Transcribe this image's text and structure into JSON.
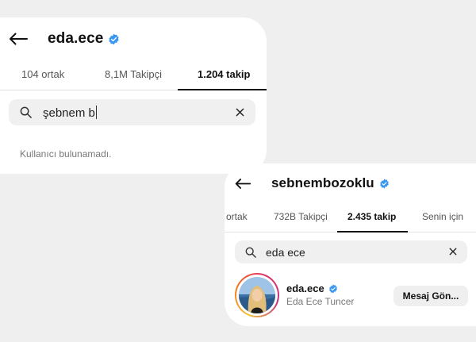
{
  "colors": {
    "verified": "#3897f0",
    "background": "#efefef",
    "card": "#ffffff",
    "search_bg": "#f0f0f0"
  },
  "card1": {
    "username": "eda.ece",
    "tabs": [
      {
        "label": "104 ortak",
        "active": false
      },
      {
        "label": "8,1M Takipçi",
        "active": false
      },
      {
        "label": "1.204 takip",
        "active": true
      }
    ],
    "search": {
      "icon": "search-icon",
      "value": "şebnem b"
    },
    "empty_message": "Kullanıcı bulunamadı."
  },
  "card2": {
    "username": "sebnembozoklu",
    "tabs": [
      {
        "label": "ortak",
        "active": false
      },
      {
        "label": "732B Takipçi",
        "active": false
      },
      {
        "label": "2.435 takip",
        "active": true
      },
      {
        "label": "Senin için",
        "active": false
      }
    ],
    "search": {
      "icon": "search-icon",
      "value": "eda ece"
    },
    "result": {
      "username": "eda.ece",
      "full_name": "Eda Ece Tuncer",
      "button_label": "Mesaj Gön..."
    }
  }
}
